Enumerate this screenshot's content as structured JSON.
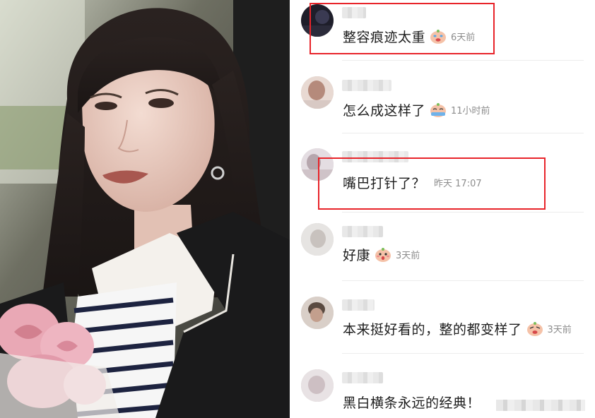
{
  "comments": [
    {
      "text": "整容痕迹太重",
      "emoji": "crying-face-emoji",
      "time": "6天前"
    },
    {
      "text": "怎么成这样了",
      "emoji": "tearful-face-emoji",
      "time": "11小时前"
    },
    {
      "text": "嘴巴打针了？",
      "emoji": "",
      "time": "昨天 17:07"
    },
    {
      "text": "好康",
      "emoji": "surprised-face-emoji",
      "time": "3天前"
    },
    {
      "text": "本来挺好看的，整的都变样了",
      "emoji": "crying-face-emoji",
      "time": "3天前"
    },
    {
      "text": "黑白横条永远的经典！",
      "emoji": "",
      "time": ""
    }
  ],
  "colors": {
    "highlight": "#e8242a",
    "text": "#1d1d1d",
    "time": "#8d8d8d"
  }
}
